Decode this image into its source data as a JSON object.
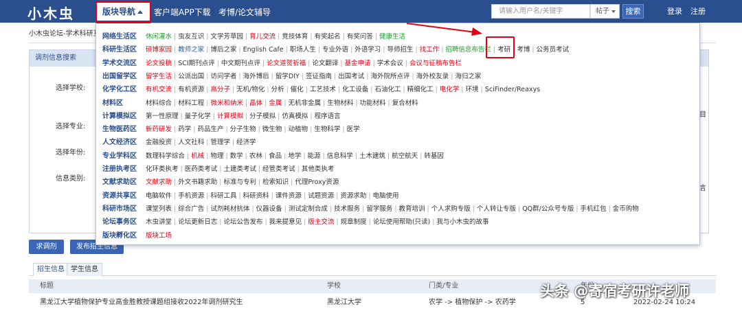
{
  "header": {
    "logo": "小木虫",
    "nav_active": "版块导航",
    "nav_links": [
      "客户端APP下载",
      "考博/论文辅导"
    ],
    "search_placeholder": "请输入用户名/关键字",
    "search_type": "帖子",
    "search_button": "搜索",
    "login": "登录",
    "register": "注册"
  },
  "page": {
    "breadcrumb": "小木虫论坛-学术科研互",
    "panel_title": "调剂信息搜索",
    "labels": [
      "选择学校:",
      "选择专业:",
      "选择年份:",
      "信息类别:"
    ],
    "edge_text": [
      "目",
      "言"
    ],
    "buttons": [
      "求调剂",
      "发布招生信息"
    ],
    "tabs": [
      "招生信息",
      "学生信息"
    ],
    "table_headers": [
      "标题",
      "学校",
      "门类/专业",
      "年份"
    ],
    "rows": [
      {
        "title": "黑龙江大学植物保护专业高金胜教授课题组接收2022年调剂研究生",
        "school": "黑龙江大学",
        "major": "农学 -> 植物保护 -> 农药学",
        "count": "5",
        "date": "2022-02-24 10:24"
      }
    ]
  },
  "menu": {
    "categories": [
      {
        "title": "网络生活区",
        "links": [
          {
            "t": "休闲灌水",
            "c": "green"
          },
          {
            "t": "虫友互识"
          },
          {
            "t": "文学芳草园"
          },
          {
            "t": "育儿交流",
            "c": "red"
          },
          {
            "t": "竞技体育"
          },
          {
            "t": "有奖起名"
          },
          {
            "t": "有奖问答"
          },
          {
            "t": "健康生活",
            "c": "green"
          }
        ]
      },
      {
        "title": "科研生活区",
        "links": [
          {
            "t": "硕博家园",
            "c": "red"
          },
          {
            "t": "教师之家",
            "c": "blue"
          },
          {
            "t": "博后之家"
          },
          {
            "t": "English Cafe"
          },
          {
            "t": "职场人生"
          },
          {
            "t": "专业外语"
          },
          {
            "t": "外语学习"
          },
          {
            "t": "导师招生"
          },
          {
            "t": "找工作",
            "c": "red"
          },
          {
            "t": "招聘信息布告栏",
            "c": "green"
          },
          {
            "t": "考研"
          },
          {
            "t": "考博"
          },
          {
            "t": "公务员考试"
          }
        ]
      },
      {
        "title": "学术交流区",
        "links": [
          {
            "t": "论文投稿",
            "c": "red"
          },
          {
            "t": "SCI期刊点评"
          },
          {
            "t": "中文期刊点评"
          },
          {
            "t": "论文道贺祈福",
            "c": "red"
          },
          {
            "t": "论文翻译"
          },
          {
            "t": "基金申请",
            "c": "red"
          },
          {
            "t": "学术会议"
          },
          {
            "t": "会议与征稿布告栏",
            "c": "red"
          }
        ]
      },
      {
        "title": "出国留学区",
        "links": [
          {
            "t": "留学生活",
            "c": "red"
          },
          {
            "t": "公派出国"
          },
          {
            "t": "访问学者"
          },
          {
            "t": "海外博后"
          },
          {
            "t": "留学DIY"
          },
          {
            "t": "签证指南"
          },
          {
            "t": "出国考试"
          },
          {
            "t": "海外院所点评"
          },
          {
            "t": "海外校友录"
          },
          {
            "t": "海归之家"
          }
        ]
      },
      {
        "title": "化学化工区",
        "links": [
          {
            "t": "有机交流",
            "c": "red"
          },
          {
            "t": "有机资源"
          },
          {
            "t": "高分子",
            "c": "red"
          },
          {
            "t": "无机/物化"
          },
          {
            "t": "分析"
          },
          {
            "t": "催化"
          },
          {
            "t": "工艺技术"
          },
          {
            "t": "化工设备"
          },
          {
            "t": "石油化工"
          },
          {
            "t": "精细化工"
          },
          {
            "t": "电化学",
            "c": "red"
          },
          {
            "t": "环境"
          },
          {
            "t": "SciFinder/Reaxys"
          }
        ]
      },
      {
        "title": "材料区",
        "links": [
          {
            "t": "材料综合"
          },
          {
            "t": "材料工程"
          },
          {
            "t": "微米和纳米",
            "c": "red"
          },
          {
            "t": "晶体",
            "c": "red"
          },
          {
            "t": "金属",
            "c": "red"
          },
          {
            "t": "无机非金属"
          },
          {
            "t": "生物材料"
          },
          {
            "t": "功能材料"
          },
          {
            "t": "复合材料"
          }
        ]
      },
      {
        "title": "计算模拟区",
        "links": [
          {
            "t": "第一性原理"
          },
          {
            "t": "量子化学"
          },
          {
            "t": "计算模拟",
            "c": "red"
          },
          {
            "t": "分子模拟"
          },
          {
            "t": "仿真模拟"
          },
          {
            "t": "程序语言"
          }
        ]
      },
      {
        "title": "生物医药区",
        "links": [
          {
            "t": "新药研发",
            "c": "red"
          },
          {
            "t": "药学"
          },
          {
            "t": "药品生产"
          },
          {
            "t": "分子生物"
          },
          {
            "t": "微生物"
          },
          {
            "t": "动植物"
          },
          {
            "t": "生物科学"
          },
          {
            "t": "医学"
          }
        ]
      },
      {
        "title": "人文经济区",
        "links": [
          {
            "t": "金融投资"
          },
          {
            "t": "人文社科"
          },
          {
            "t": "管理学"
          },
          {
            "t": "经济学"
          }
        ]
      },
      {
        "title": "专业学科区",
        "links": [
          {
            "t": "数理科学综合"
          },
          {
            "t": "机械",
            "c": "red"
          },
          {
            "t": "物理"
          },
          {
            "t": "数学"
          },
          {
            "t": "农林"
          },
          {
            "t": "食品"
          },
          {
            "t": "地学"
          },
          {
            "t": "能源"
          },
          {
            "t": "信息科学"
          },
          {
            "t": "土木建筑"
          },
          {
            "t": "航空航天"
          },
          {
            "t": "转基因"
          }
        ]
      },
      {
        "title": "注册执考区",
        "links": [
          {
            "t": "化环类执考"
          },
          {
            "t": "医药类考试"
          },
          {
            "t": "土建类考试"
          },
          {
            "t": "经管类考试"
          },
          {
            "t": "其他类执考"
          }
        ]
      },
      {
        "title": "文献求助区",
        "links": [
          {
            "t": "文献求助",
            "c": "red"
          },
          {
            "t": "外文书籍求助"
          },
          {
            "t": "标准与专利"
          },
          {
            "t": "检索知识"
          },
          {
            "t": "代理Proxy资源"
          }
        ]
      },
      {
        "title": "资源共享区",
        "links": [
          {
            "t": "电脑软件"
          },
          {
            "t": "手机资源"
          },
          {
            "t": "科研工具"
          },
          {
            "t": "科研资料"
          },
          {
            "t": "课件资源"
          },
          {
            "t": "试题资源"
          },
          {
            "t": "资源求助"
          },
          {
            "t": "电脑使用"
          }
        ]
      },
      {
        "title": "科研市场区",
        "links": [
          {
            "t": "课堂列表"
          },
          {
            "t": "综合广告"
          },
          {
            "t": "试剂耗材抗体"
          },
          {
            "t": "仪器设备"
          },
          {
            "t": "测试定制合成"
          },
          {
            "t": "技术服务"
          },
          {
            "t": "留学服务"
          },
          {
            "t": "教育培训"
          },
          {
            "t": "个人求购专版"
          },
          {
            "t": "个人转让专版"
          },
          {
            "t": "QQ群/公众号专版"
          },
          {
            "t": "手机红包"
          },
          {
            "t": "金币购物"
          }
        ]
      },
      {
        "title": "论坛事务区",
        "links": [
          {
            "t": "木虫讲堂"
          },
          {
            "t": "论坛更新日志"
          },
          {
            "t": "论坛公告发布"
          },
          {
            "t": "我来提意见"
          },
          {
            "t": "版主交流",
            "c": "red"
          },
          {
            "t": "规章制度"
          },
          {
            "t": "论坛使用帮助(只读)"
          },
          {
            "t": "我与小木虫的故事"
          }
        ]
      },
      {
        "title": "版块孵化区",
        "links": [
          {
            "t": "版块工场",
            "c": "red"
          }
        ]
      }
    ]
  },
  "watermark": "头条 @寄宿考研许老师",
  "colors": {
    "header_bg": "#2b4f8e",
    "accent_red": "#e60012",
    "link_green": "#1f9d2a",
    "link_blue": "#2a5db0"
  }
}
